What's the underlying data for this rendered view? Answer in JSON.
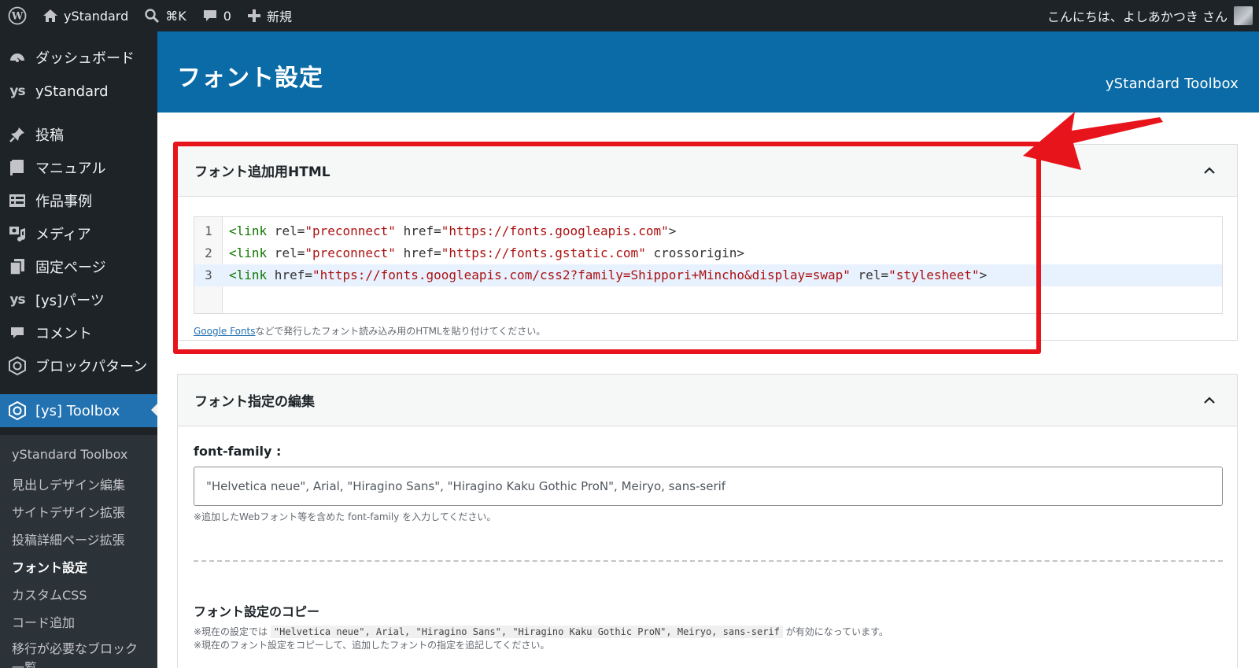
{
  "adminbar": {
    "site_name": "yStandard",
    "search_shortcut": "⌘K",
    "comments_count": "0",
    "new_label": "新規",
    "greeting": "こんにちは、よしあかつき さん"
  },
  "sidebar": {
    "items": [
      {
        "label": "ダッシュボード",
        "icon": "dashboard-icon"
      },
      {
        "label": "yStandard",
        "icon": "ys-logo"
      },
      {
        "label": "投稿",
        "icon": "pin-icon"
      },
      {
        "label": "マニュアル",
        "icon": "book-icon"
      },
      {
        "label": "作品事例",
        "icon": "list-icon"
      },
      {
        "label": "メディア",
        "icon": "media-icon"
      },
      {
        "label": "固定ページ",
        "icon": "pages-icon"
      },
      {
        "label": "[ys]パーツ",
        "icon": "ys-logo"
      },
      {
        "label": "コメント",
        "icon": "comment-icon"
      },
      {
        "label": "ブロックパターン",
        "icon": "hexagon-icon"
      },
      {
        "label": "[ys] Toolbox",
        "icon": "hexagon-icon"
      }
    ],
    "submenu": [
      "yStandard Toolbox",
      "見出しデザイン編集",
      "サイトデザイン拡張",
      "投稿詳細ページ拡張",
      "フォント設定",
      "カスタムCSS",
      "コード追加",
      "移行が必要なブロック一覧"
    ],
    "ys_logo_text": "ys"
  },
  "header": {
    "title": "フォント設定",
    "brand": "yStandard Toolbox"
  },
  "panel_html": {
    "title": "フォント追加用HTML",
    "code_lines": [
      {
        "num": "1",
        "tag": "<link",
        "parts": [
          [
            " rel=",
            "attr"
          ],
          [
            "\"preconnect\"",
            "str"
          ],
          [
            " href=",
            "attr"
          ],
          [
            "\"https://fonts.googleapis.com\"",
            "str"
          ],
          [
            ">",
            "attr"
          ]
        ]
      },
      {
        "num": "2",
        "tag": "<link",
        "parts": [
          [
            " rel=",
            "attr"
          ],
          [
            "\"preconnect\"",
            "str"
          ],
          [
            " href=",
            "attr"
          ],
          [
            "\"https://fonts.gstatic.com\"",
            "str"
          ],
          [
            " crossorigin>",
            "attr"
          ]
        ]
      },
      {
        "num": "3",
        "tag": "<link",
        "parts": [
          [
            " href=",
            "attr"
          ],
          [
            "\"https://fonts.googleapis.com/css2?family=Shippori+Mincho&display=swap\"",
            "str"
          ],
          [
            " rel=",
            "attr"
          ],
          [
            "\"stylesheet\"",
            "str"
          ],
          [
            ">",
            "attr"
          ]
        ]
      }
    ],
    "help_link": "Google Fonts",
    "help_text": "などで発行したフォント読み込み用のHTMLを貼り付けてください。"
  },
  "panel_font": {
    "title": "フォント指定の編集",
    "field_label": "font-family :",
    "field_value": "\"Helvetica neue\", Arial, \"Hiragino Sans\", \"Hiragino Kaku Gothic ProN\", Meiryo, sans-serif",
    "field_help": "※追加したWebフォント等を含めた font-family を入力してください。",
    "copy_title": "フォント設定のコピー",
    "copy_note1_pre": "※現在の設定では",
    "copy_note1_code": "\"Helvetica neue\", Arial, \"Hiragino Sans\", \"Hiragino Kaku Gothic ProN\", Meiryo, sans-serif",
    "copy_note1_post": "が有効になっています。",
    "copy_note2": "※現在のフォント設定をコピーして、追加したフォントの指定を追記してください。"
  },
  "colors": {
    "adminbar": "#1d2327",
    "header": "#0a6ba6",
    "active_menu": "#2271b1",
    "annotation": "#e8141b"
  }
}
